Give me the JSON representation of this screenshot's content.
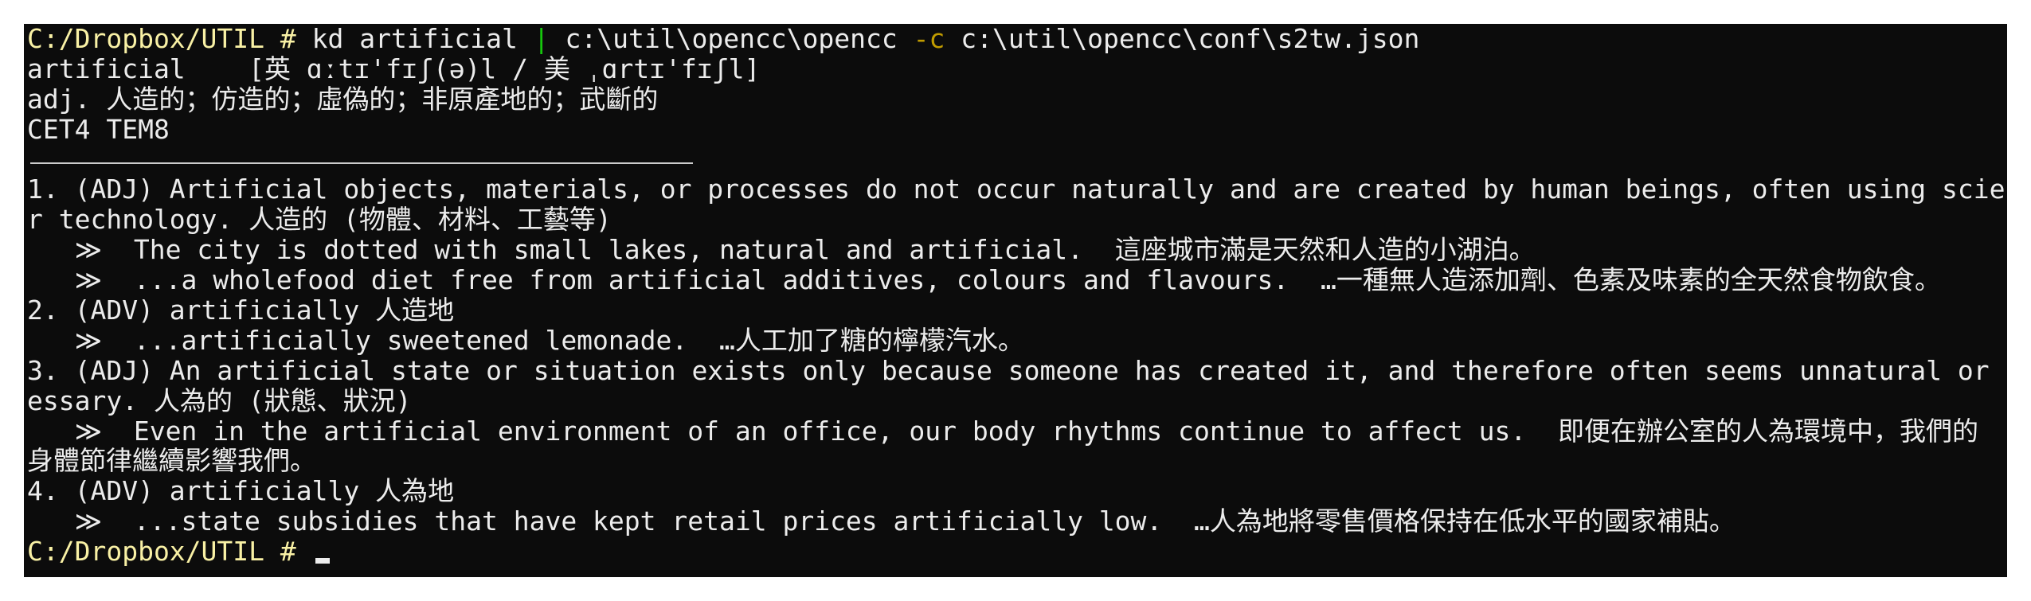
{
  "terminal": {
    "prompt": "C:/Dropbox/UTIL # ",
    "command_a": "kd artificial ",
    "pipe": "|",
    "command_b": " c:\\util\\opencc\\opencc ",
    "flag": "-c",
    "command_c": " c:\\util\\opencc\\conf\\s2tw.json",
    "output": [
      "artificial    [英 ɑːtɪ'fɪʃ(ə)l / 美 ˌɑrtɪ'fɪʃl]",
      "adj. 人造的；仿造的；虛偽的；非原產地的；武斷的",
      "CET4 TEM8"
    ],
    "definitions": [
      "1. (ADJ) Artificial objects, materials, or processes do not occur naturally and are created by human beings, often using science o",
      "r technology. 人造的 (物體、材料、工藝等)",
      "   ≫  The city is dotted with small lakes, natural and artificial.  這座城市滿是天然和人造的小湖泊。",
      "   ≫  ...a wholefood diet free from artificial additives, colours and flavours.  …一種無人造添加劑、色素及味素的全天然食物飲食。",
      "2. (ADV) artificially 人造地",
      "   ≫  ...artificially sweetened lemonade.  …人工加了糖的檸檬汽水。",
      "3. (ADJ) An artificial state or situation exists only because someone has created it, and therefore often seems unnatural or unnec",
      "essary. 人為的 (狀態、狀況)",
      "   ≫  Even in the artificial environment of an office, our body rhythms continue to affect us.  即便在辦公室的人為環境中，我們的",
      "身體節律繼續影響我們。",
      "4. (ADV) artificially 人為地",
      "   ≫  ...state subsidies that have kept retail prices artificially low.  …人為地將零售價格保持在低水平的國家補貼。"
    ],
    "final_prompt": "C:/Dropbox/UTIL # "
  }
}
